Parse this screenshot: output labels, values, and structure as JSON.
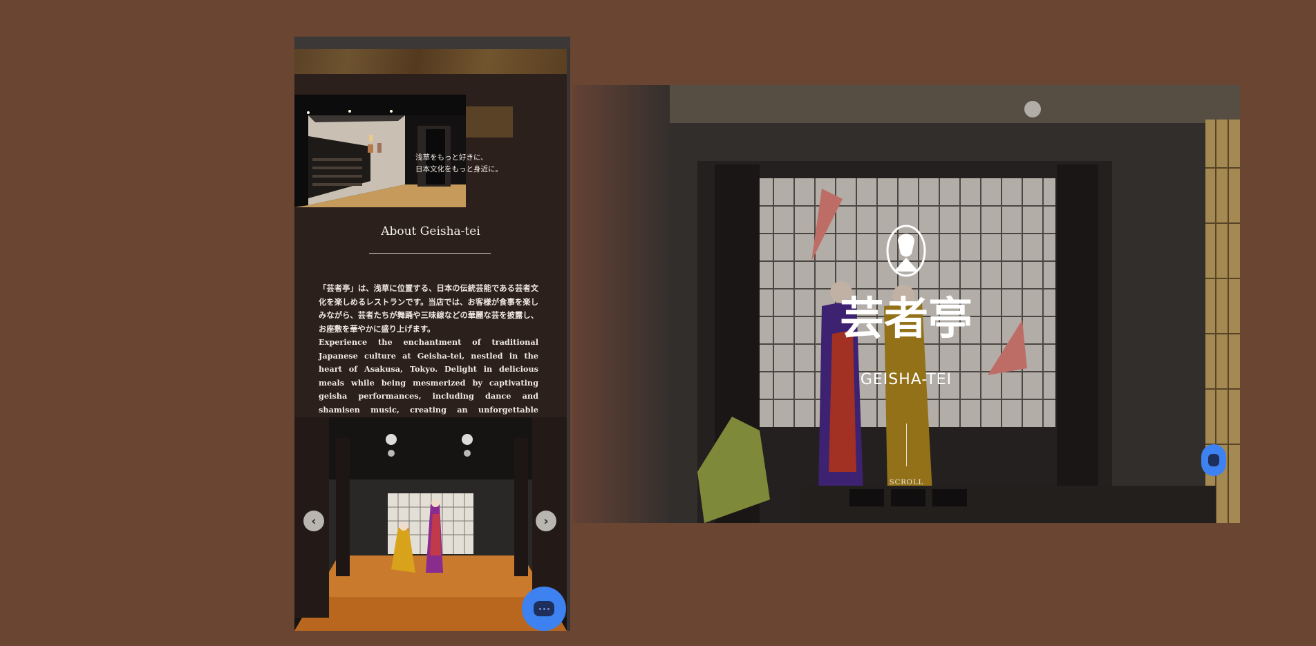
{
  "mobile": {
    "tagline": [
      "浅草をもっと好きに、",
      "日本文化をもっと身近に。"
    ],
    "about_title": "About Geisha-tei",
    "about_jp": "「芸者亭」は、浅草に位置する、日本の伝統芸能である芸者文化を楽しめるレストランです。当店では、お客様が食事を楽しみながら、芸者たちが舞踊や三味線などの華麗な芸を披露し、お座敷を華やかに盛り上げます。",
    "about_en": "Experience the enchantment of traditional Japanese culture at Geisha-tei, nestled in the heart of Asakusa, Tokyo. Delight in delicious meals while being mesmerized by captivating geisha performances, including dance and shamisen music, creating an unforgettable experience.",
    "slider": {
      "prev": "‹",
      "next": "›"
    }
  },
  "hero": {
    "logo_kanji": "芸者亭",
    "logo_roman": "GEISHA-TEI",
    "scroll_label": "SCROLL"
  },
  "icons": {
    "chat": "chat-bubble-icon",
    "emblem": "geisha-emblem-icon"
  },
  "colors": {
    "page_bg": "#6a4531",
    "panel_bg": "#2b201c",
    "chat_blue": "#3d82f0"
  }
}
